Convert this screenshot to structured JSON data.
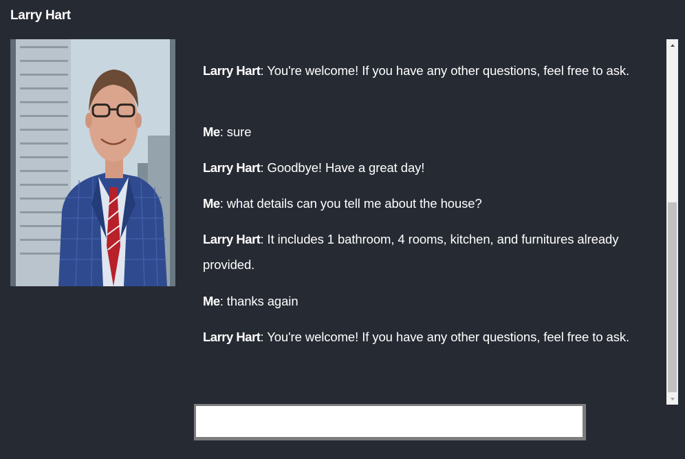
{
  "header": {
    "title": "Larry Hart"
  },
  "chat": {
    "messages": [
      {
        "speaker": "Larry Hart",
        "text": "You're welcome! If you have any other questions, feel free to ask."
      },
      {
        "speaker": "Me",
        "text": "sure"
      },
      {
        "speaker": "Larry Hart",
        "text": "Goodbye! Have a great day!"
      },
      {
        "speaker": "Me",
        "text": "what details can you tell me about the house?"
      },
      {
        "speaker": "Larry Hart",
        "text": "It includes 1 bathroom, 4 rooms, kitchen, and furnitures already provided."
      },
      {
        "speaker": "Me",
        "text": "thanks again"
      },
      {
        "speaker": "Larry Hart",
        "text": "You're welcome! If you have any other questions, feel free to ask."
      }
    ],
    "separator": ": "
  },
  "input": {
    "value": "",
    "placeholder": ""
  },
  "colors": {
    "background": "#262a33",
    "text": "#ffffff",
    "input_border": "#7d7d7d"
  }
}
